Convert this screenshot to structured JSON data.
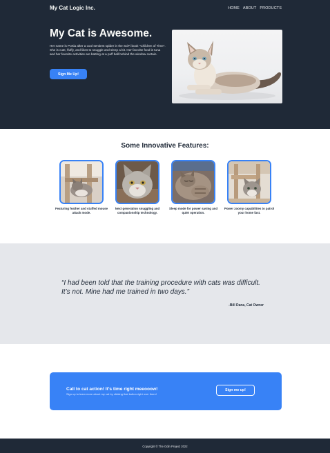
{
  "header": {
    "logo": "My Cat Logic Inc.",
    "nav": [
      "HOME",
      "ABOUT",
      "PRODUCTS"
    ]
  },
  "hero": {
    "title": "My Cat is Awesome.",
    "text": "Her name is Portia after a cool sentient spider in the SciFi book \"Children of Time\". She is cute, fluffy, and likes to snuggle and sleep a bit. Her favorite food is tuna and her favorite activities are batting at a puff ball behind the window curtain.",
    "button": "Sign Me Up!",
    "image_icon": "cat-photo"
  },
  "features": {
    "title": "Some Innovative Features:",
    "items": [
      {
        "caption": "Featuring feather and stuffed mouse attack mode.",
        "icon": "cat-on-chair-photo"
      },
      {
        "caption": "Next generation snuggling and companionship technology.",
        "icon": "cat-face-photo"
      },
      {
        "caption": "Sleep mode for power saving and quiet operation.",
        "icon": "sleeping-cat-photo"
      },
      {
        "caption": "Power zoomy capabilities to patrol your home fast.",
        "icon": "cat-under-chair-photo"
      }
    ]
  },
  "quote": {
    "text": "“I had been told that the training procedure with cats was difficult. It’s not. Mine had me trained in two days.”",
    "author": "-Bill Dana, Cat Owner"
  },
  "cta": {
    "title": "Call to cat action! It's time right meeooow!",
    "subtitle": "Sign up to learn more about my cat by clicking that button right over there!",
    "button": "Sign me up!"
  },
  "footer": {
    "text": "Copyright © The Odin Project 2022"
  },
  "colors": {
    "dark": "#1f2937",
    "accent": "#3882f6",
    "light_gray": "#e5e7eb",
    "off_white": "#f9faf8"
  }
}
